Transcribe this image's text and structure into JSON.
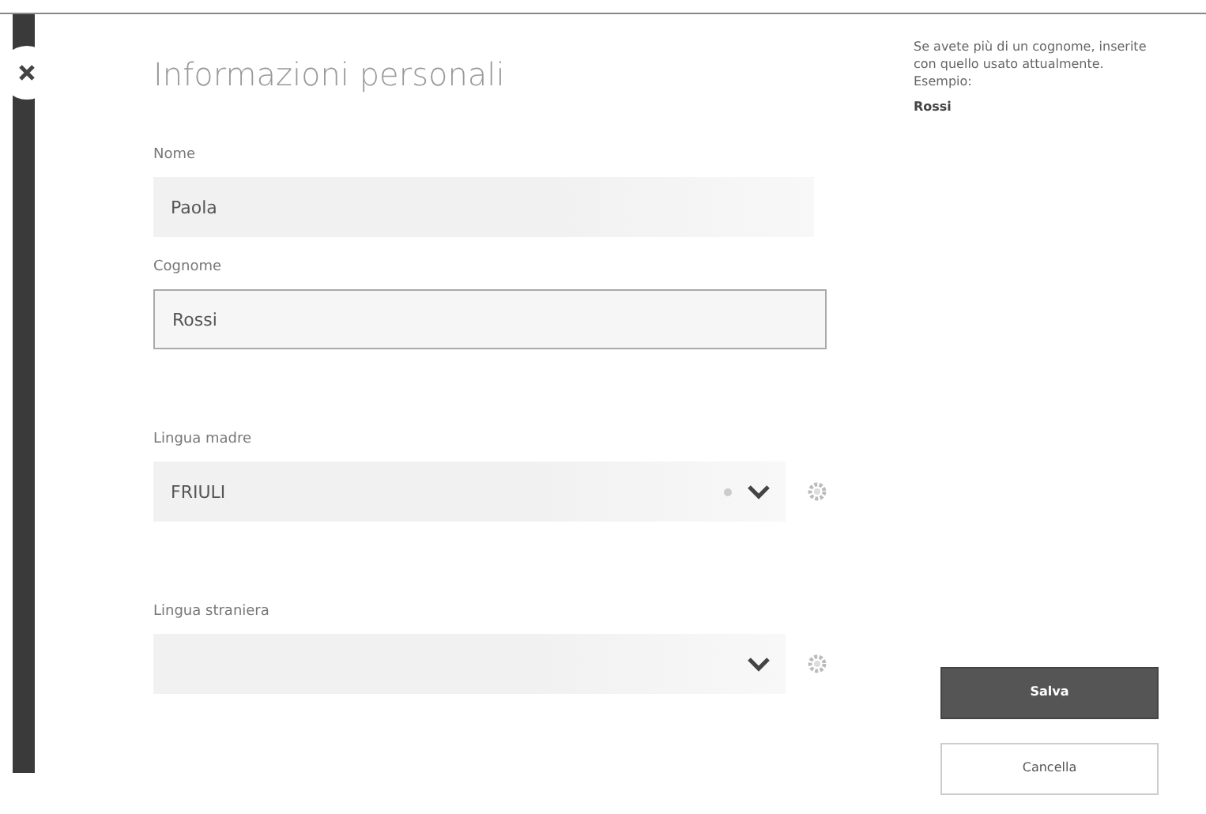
{
  "title": "Informazioni personali",
  "fields": [
    {
      "kind": "text",
      "label": "Nome",
      "value": "Paola",
      "focused": false
    },
    {
      "kind": "text",
      "label": "Cognome",
      "value": "Rossi",
      "focused": true
    },
    {
      "kind": "select",
      "label": "Lingua madre",
      "value": "FRIULI",
      "clearable": true
    },
    {
      "kind": "select",
      "label": "Lingua straniera",
      "clearable": false
    }
  ],
  "help": {
    "text": "Se avete più di un cognome, inserite con quello usato attualmente. Esempio:",
    "example": "Rossi"
  },
  "buttons": [
    {
      "label": "Salva",
      "primary": true
    },
    {
      "label": "Cancella",
      "primary": false
    }
  ]
}
